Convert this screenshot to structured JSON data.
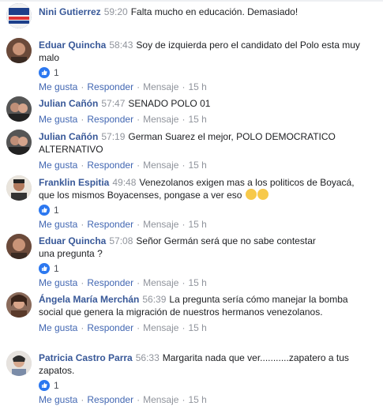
{
  "actions": {
    "like": "Me gusta",
    "reply": "Responder",
    "message": "Mensaje",
    "time": "15 h",
    "sep": "·"
  },
  "colors": {
    "name": "#385898",
    "link": "#4267b2",
    "meta": "#90949c",
    "like_blue": "#2c78f0"
  },
  "comments": [
    {
      "author": "Nini Gutierrez",
      "timestamp": "59:20",
      "text": "Falta mucho en educación. Demasiado!",
      "likes": null,
      "avatar_icon": "avatar-photo"
    },
    {
      "author": "Eduar Quincha",
      "timestamp": "58:43",
      "text": "Soy de izquierda pero el candidato del Polo esta muy malo",
      "likes": "1",
      "avatar_icon": "avatar-photo"
    },
    {
      "author": "Julian Cañón",
      "timestamp": "57:47",
      "text": "SENADO POLO 01",
      "likes": null,
      "avatar_icon": "avatar-photo"
    },
    {
      "author": "Julian Cañón",
      "timestamp": "57:19",
      "text": "German Suarez el mejor, POLO DEMOCRATICO ALTERNATIVO",
      "likes": null,
      "avatar_icon": "avatar-photo"
    },
    {
      "author": "Franklin Espitia",
      "timestamp": "49:48",
      "text": "Venezolanos exigen mas a los politicos de Boyacá, que los mismos Boyacenses, pongase a ver eso",
      "likes": "1",
      "avatar_icon": "avatar-photo",
      "emoji": [
        "thinking-emoji",
        "thinking-emoji"
      ]
    },
    {
      "author": "Eduar Quincha",
      "timestamp": "57:08",
      "text": "Señor Germán será que no sabe contestar una pregunta ?",
      "likes": "1",
      "avatar_icon": "avatar-photo"
    },
    {
      "author": "Ángela María Merchán",
      "timestamp": "56:39",
      "text": "La pregunta sería cómo manejar la bomba social que genera la migración de nuestros hermanos venezolanos.",
      "likes": null,
      "avatar_icon": "avatar-photo"
    },
    {
      "author": "Patricia Castro Parra",
      "timestamp": "56:33",
      "text": "Margarita nada que ver...........zapatero a tus zapatos.",
      "likes": "1",
      "avatar_icon": "avatar-photo"
    }
  ]
}
